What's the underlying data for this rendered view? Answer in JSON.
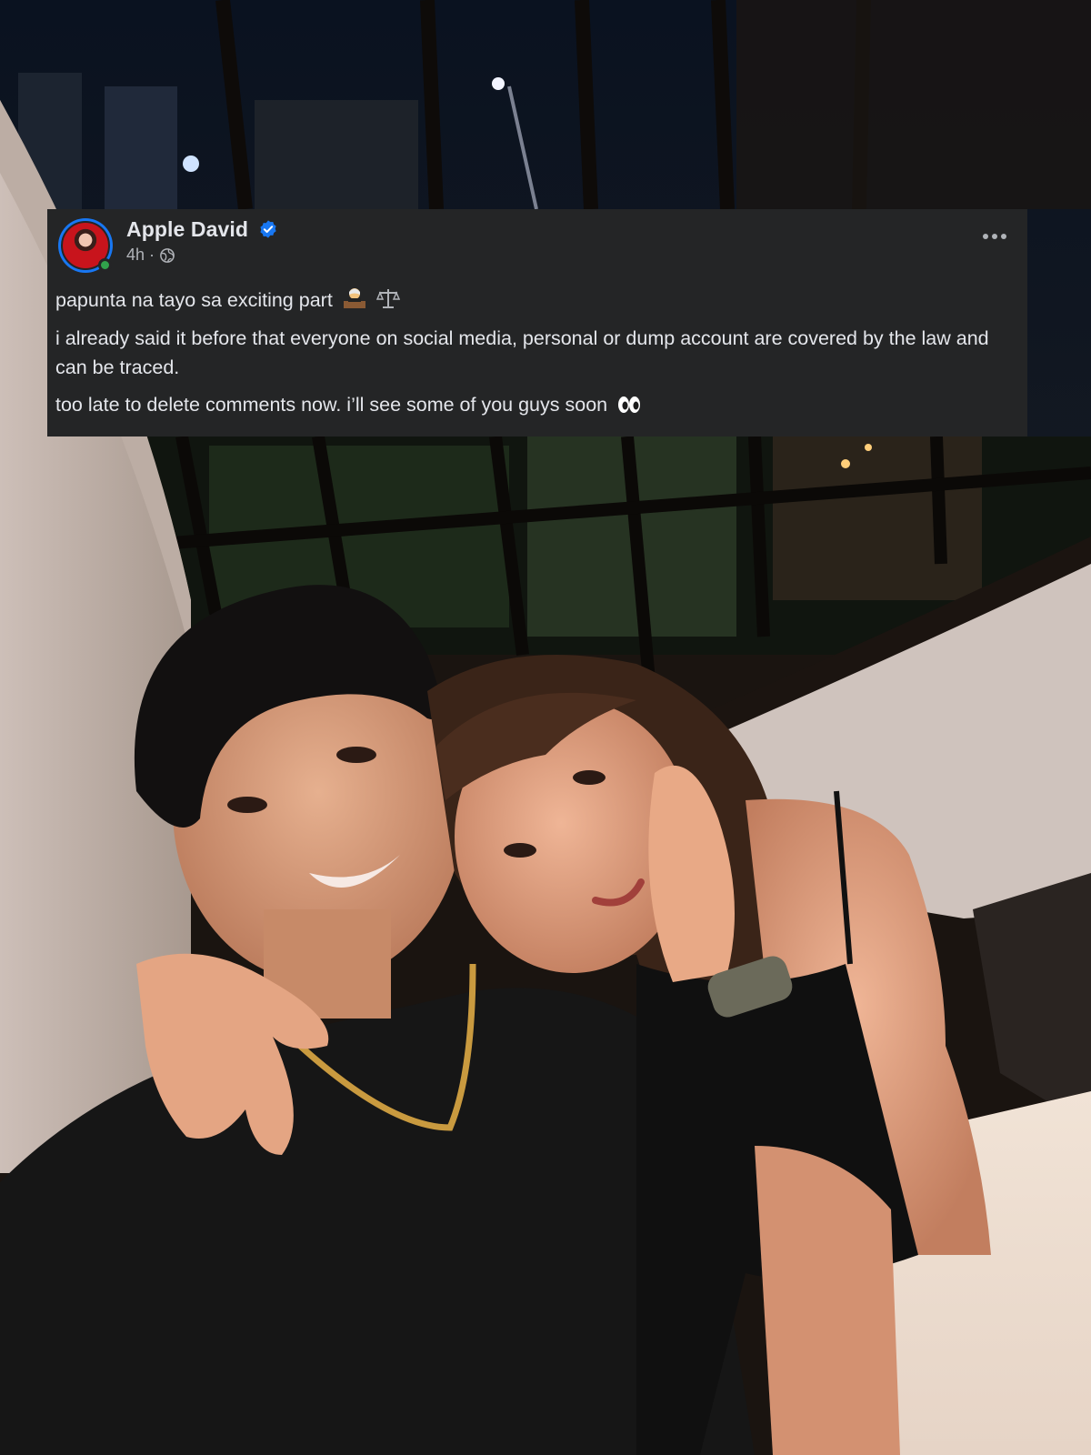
{
  "post": {
    "author_name": "Apple David",
    "timestamp": "4h",
    "separator": "·",
    "icons": {
      "verified": "verified-badge-icon",
      "audience": "globe-icon",
      "more": "more-options-icon"
    },
    "paragraphs": {
      "line1": "papunta na tayo sa exciting part",
      "line2": "i already said it before that everyone on social media, personal or dump account are covered by the law and can be traced.",
      "line3": "too late to delete comments now. i’ll see some of you guys soon"
    },
    "emojis": {
      "line1": [
        "judge-emoji",
        "balance-scale-emoji"
      ],
      "line3": [
        "eyes-emoji"
      ]
    },
    "colors": {
      "card_bg": "#242526",
      "text": "#e4e6eb",
      "secondary_text": "#b0b3b8",
      "verified_blue": "#1877f2",
      "online_green": "#31a24c"
    }
  }
}
